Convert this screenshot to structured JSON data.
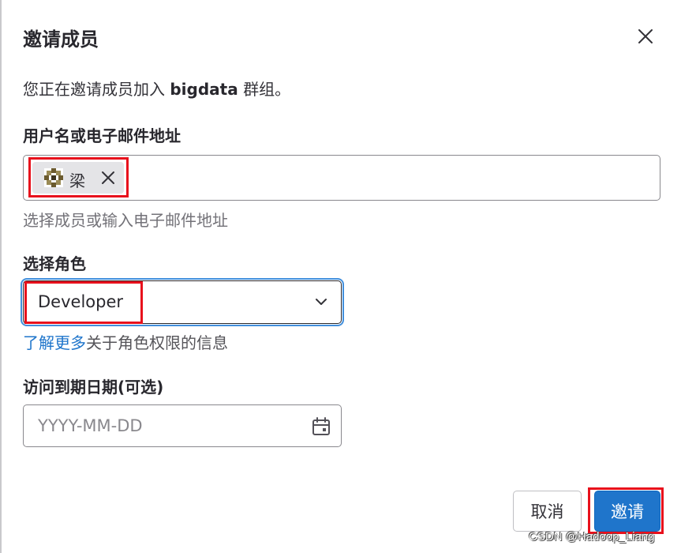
{
  "dialog": {
    "title": "邀请成员",
    "description_prefix": "您正在邀请成员加入 ",
    "group_name": "bigdata",
    "description_suffix": " 群组。"
  },
  "user_field": {
    "label": "用户名或电子邮件地址",
    "selected_users": [
      {
        "name": "梁",
        "avatar": "pixel-identicon"
      }
    ],
    "hint": "选择成员或输入电子邮件地址"
  },
  "role_field": {
    "label": "选择角色",
    "selected": "Developer",
    "learn_more_link": "了解更多",
    "learn_more_text": "关于角色权限的信息"
  },
  "expiry_field": {
    "label": "访问到期日期(可选)",
    "placeholder": "YYYY-MM-DD"
  },
  "buttons": {
    "cancel": "取消",
    "invite": "邀请"
  },
  "watermark": "CSDN @Hadoop_Liang",
  "colors": {
    "primary": "#1f75cb",
    "focus_ring": "#428fdc",
    "annotation_red": "#e8101c"
  }
}
